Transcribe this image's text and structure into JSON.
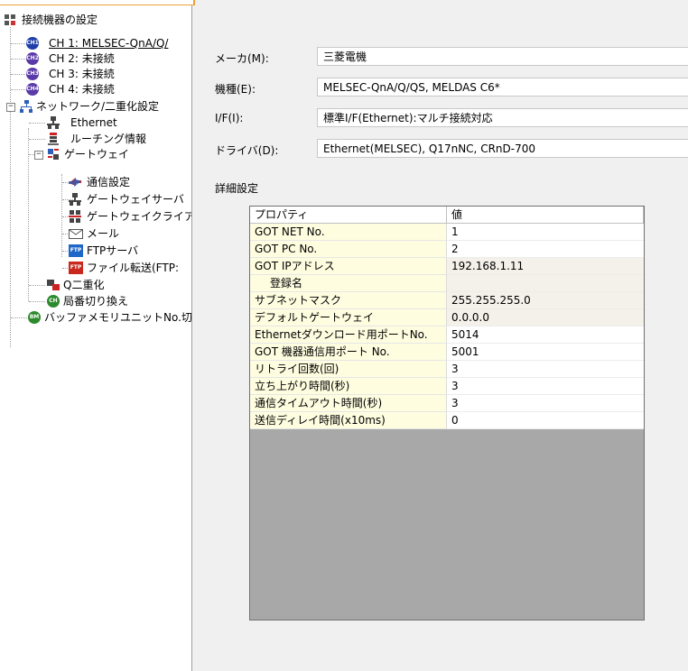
{
  "tree": {
    "root": "接続機器の設定",
    "items": [
      {
        "label": "CH 1: MELSEC-QnA/Q/",
        "badge": "CH1"
      },
      {
        "label": "CH 2: 未接続",
        "badge": "CH2"
      },
      {
        "label": "CH 3: 未接続",
        "badge": "CH3"
      },
      {
        "label": "CH 4: 未接続",
        "badge": "CH4"
      },
      {
        "label": "ネットワーク/二重化設定"
      },
      {
        "label": "Ethernet"
      },
      {
        "label": "ルーチング情報"
      },
      {
        "label": "ゲートウェイ"
      },
      {
        "label": "通信設定"
      },
      {
        "label": "ゲートウェイサーバ"
      },
      {
        "label": "ゲートウェイクライア"
      },
      {
        "label": "メール"
      },
      {
        "label": "FTPサーバ",
        "badge": "FTP"
      },
      {
        "label": "ファイル転送(FTP:",
        "badge": "FTP"
      },
      {
        "label": "Q二重化"
      },
      {
        "label": "局番切り換え",
        "badge": "CH"
      },
      {
        "label": "バッファメモリユニットNo.切り",
        "badge": "BM"
      }
    ]
  },
  "form": {
    "maker_label": "メーカ(M):",
    "maker_value": "三菱電機",
    "model_label": "機種(E):",
    "model_value": "MELSEC-QnA/Q/QS, MELDAS C6*",
    "if_label": "I/F(I):",
    "if_value": "標準I/F(Ethernet):マルチ接続対応",
    "driver_label": "ドライバ(D):",
    "driver_value": "Ethernet(MELSEC), Q17nNC, CRnD-700",
    "detail_label": "詳細設定"
  },
  "grid": {
    "col_property": "プロパティ",
    "col_value": "値",
    "rows": [
      {
        "property": "GOT NET No.",
        "value": "1"
      },
      {
        "property": "GOT PC No.",
        "value": "2"
      },
      {
        "property": "GOT IPアドレス",
        "value": "192.168.1.11"
      },
      {
        "property": "登録名",
        "value": ""
      },
      {
        "property": "サブネットマスク",
        "value": "255.255.255.0"
      },
      {
        "property": "デフォルトゲートウェイ",
        "value": "0.0.0.0"
      },
      {
        "property": "Ethernetダウンロード用ポートNo.",
        "value": "5014"
      },
      {
        "property": "GOT 機器通信用ポート No.",
        "value": "5001"
      },
      {
        "property": "リトライ回数(回)",
        "value": "3"
      },
      {
        "property": "立ち上がり時間(秒)",
        "value": "3"
      },
      {
        "property": "通信タイムアウト時間(秒)",
        "value": "3"
      },
      {
        "property": "送信ディレイ時間(x10ms)",
        "value": "0"
      }
    ]
  }
}
